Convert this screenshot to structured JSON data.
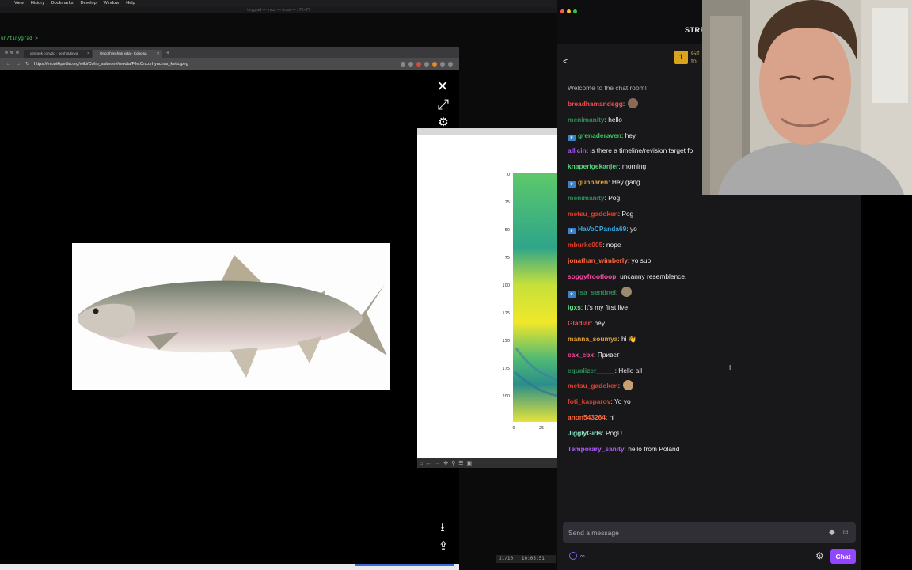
{
  "menubar": {
    "items": [
      "View",
      "History",
      "Bookmarks",
      "Develop",
      "Window",
      "Help"
    ]
  },
  "terminal": {
    "title": "tinygrad — tmux — tmux — 170×77",
    "prompt": "un/tinygrad >",
    "status_date": "31/10",
    "status_time": "10:05:51"
  },
  "browser": {
    "tabs": [
      {
        "label": "gimgrek conv2d · geohot/tinyg",
        "active": false
      },
      {
        "label": "Oncorhynchus keta - Coho sa",
        "active": true
      }
    ],
    "new_tab": "+",
    "url": "https://en.wikipedia.org/wiki/Coho_salmon#/media/File:Oncorhynchus_keta.jpeg",
    "viewer_close": "✕",
    "viewer_expand": "⤢",
    "viewer_settings": "⚙",
    "viewer_download": "⭳",
    "viewer_share": "⇪"
  },
  "plot": {
    "y_ticks": [
      "0",
      "25",
      "50",
      "75",
      "100",
      "125",
      "150",
      "175",
      "200"
    ],
    "x_ticks": [
      "0",
      "25"
    ],
    "toolbar_icons": [
      "⌂",
      "←",
      "→",
      "✥",
      "⚲",
      "☰",
      "▣"
    ]
  },
  "chat": {
    "stream_title": "STRE",
    "gift_count": "1",
    "gift_text": [
      "Gif",
      "to"
    ],
    "welcome": "Welcome to the chat room!",
    "messages": [
      {
        "user": "breadhamandegg",
        "color": "#ff4a4a",
        "text": "",
        "badge": false,
        "emote": "#8a6a55"
      },
      {
        "user": "menimanity",
        "color": "#2e8b57",
        "text": "hello",
        "badge": false
      },
      {
        "user": "grenaderaven",
        "color": "#34c759",
        "text": "hey",
        "badge": true
      },
      {
        "user": "allicin",
        "color": "#b15cff",
        "text": "is there a timeline/revision target fo",
        "badge": false
      },
      {
        "user": "knaperigekanjer",
        "color": "#54d67a",
        "text": "morning",
        "badge": false
      },
      {
        "user": "gunnaren",
        "color": "#e0a33a",
        "text": "Hey gang",
        "badge": true
      },
      {
        "user": "menimanity",
        "color": "#2e8b57",
        "text": "Pog",
        "badge": false
      },
      {
        "user": "metsu_gadoken",
        "color": "#e0402a",
        "text": "Pog",
        "badge": false
      },
      {
        "user": "HaVoCPanda69",
        "color": "#3da8e0",
        "text": "yo",
        "badge": true
      },
      {
        "user": "mburke005",
        "color": "#e0402a",
        "text": "nope",
        "badge": false
      },
      {
        "user": "jonathan_wimberly",
        "color": "#ff6b3d",
        "text": "yo sup",
        "badge": false
      },
      {
        "user": "soggyfrootloop",
        "color": "#ff4aa8",
        "text": "uncanny resemblence.",
        "badge": false
      },
      {
        "user": "isa_sentinel",
        "color": "#2e8b57",
        "text": "",
        "badge": true,
        "emote": "#9a8a70"
      },
      {
        "user": "igxs",
        "color": "#6be38a",
        "text": "It's my first live",
        "badge": false
      },
      {
        "user": "Gladiar",
        "color": "#ff4a4a",
        "text": "hey",
        "badge": false
      },
      {
        "user": "manna_soumya",
        "color": "#e0a33a",
        "text": "hi 👋",
        "badge": false
      },
      {
        "user": "eax_ebx",
        "color": "#ff4aa8",
        "text": "Привет",
        "badge": false
      },
      {
        "user": "equalizer_____",
        "color": "#2e8b57",
        "text": "Hello all",
        "badge": false
      },
      {
        "user": "metsu_gadoken",
        "color": "#e0402a",
        "text": "",
        "badge": false,
        "emote": "#c8a070"
      },
      {
        "user": "foti_kasparov",
        "color": "#e0402a",
        "text": "Yo yo",
        "badge": false
      },
      {
        "user": "anon543264",
        "color": "#ff6b3d",
        "text": "hi",
        "badge": false
      },
      {
        "user": "JigglyGirls",
        "color": "#8fe8c0",
        "text": "PogU",
        "badge": false
      },
      {
        "user": "Temporary_sanity",
        "color": "#b15cff",
        "text": "hello from Poland",
        "badge": false
      }
    ],
    "input_placeholder": "Send a message",
    "points": "∞",
    "chat_button": "Chat"
  }
}
